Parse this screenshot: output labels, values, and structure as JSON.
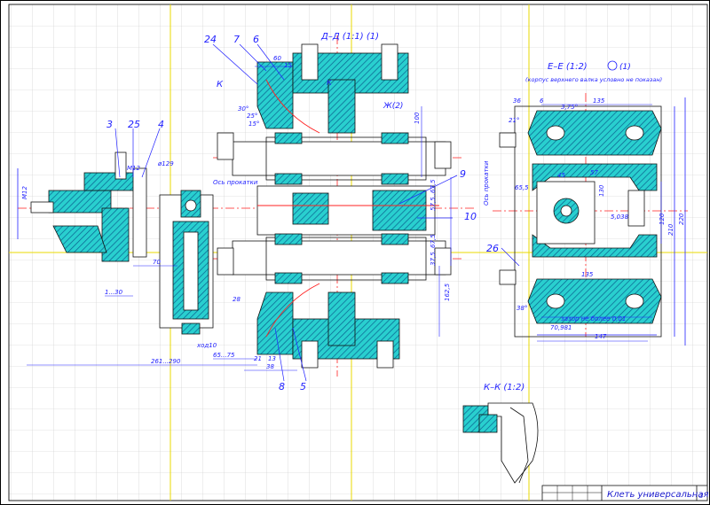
{
  "sections": {
    "dd": "Д–Д  (1:1)  (1)",
    "ee": "Е–Е  (1:2)",
    "ee_mark": "(1)",
    "ee_note": "(корпус верхнего валка условно не показан)",
    "kk": "К–К  (1:2)"
  },
  "part_numbers": {
    "p24": "24",
    "p7": "7",
    "p6": "6",
    "p3": "3",
    "p25": "25",
    "p4": "4",
    "p9": "9",
    "p10": "10",
    "p8": "8",
    "p5": "5",
    "p26": "26"
  },
  "marks": {
    "k_left": "К",
    "k_mid": "К",
    "zh": "Ж(2)",
    "rolling_axis_1": "Ось прокатки",
    "rolling_axis_2": "Ось прокатки"
  },
  "dimensions": {
    "d261": "261...290",
    "d65": "65...75",
    "d38": "38",
    "d21": "21",
    "d13": "13",
    "d28": "28",
    "d70": "70",
    "d1_30": "1...30",
    "d60": "60",
    "d15": "15",
    "d100": "100",
    "d57_5": "57,5..67,5",
    "d37_5": "37,5..67,5",
    "d162_5": "162,5",
    "d30": "30°",
    "d25": "25°",
    "d15b": "15°",
    "d129": "ø129",
    "m12a": "М12",
    "m12b": "М12",
    "d135t": "135",
    "d36": "36",
    "d6": "6",
    "d21b": "21°",
    "d3_75": "3,75°",
    "d45": "45",
    "d57": "57",
    "d65_5": "65,5",
    "d130": "130",
    "d120": "120",
    "d210": "210",
    "d220": "220",
    "d38b": "38°",
    "d135b": "135",
    "d147": "147",
    "d70_981": "70,981",
    "d5_038": "5,038",
    "gap": "зазор не более 0,01",
    "stroke": "ход10"
  },
  "title_block": {
    "title": "Клеть универсальная",
    "sheet": "3"
  }
}
